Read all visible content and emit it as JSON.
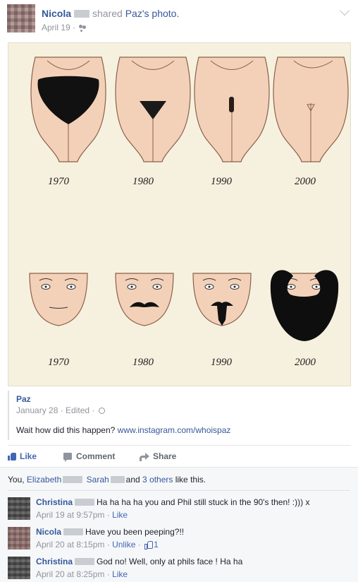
{
  "post": {
    "author": "Nicola",
    "action_text": "shared",
    "shared_owner": "Paz",
    "shared_suffix": "'s photo.",
    "date": "April 19",
    "separator": " · "
  },
  "photo": {
    "years_top": [
      "1970",
      "1980",
      "1990",
      "2000"
    ],
    "years_bottom": [
      "1970",
      "1980",
      "1990",
      "2000"
    ]
  },
  "shared": {
    "author": "Paz",
    "date": "January 28",
    "edited": "Edited",
    "caption_prefix": "Wait how did this happen? ",
    "caption_link": "www.instagram.com/whoispaz"
  },
  "actions": {
    "like": "Like",
    "comment": "Comment",
    "share": "Share"
  },
  "likes": {
    "you": "You, ",
    "name1": "Elizabeth",
    "name2": "Sarah",
    "and": "and ",
    "others": "3 others",
    "suffix": " like this."
  },
  "comments": [
    {
      "name": "Christina",
      "text": "Ha ha ha ha you and Phil still stuck in the 90's then! :))) x",
      "time": "April 19 at 9:57pm",
      "action": "Like"
    },
    {
      "name": "Nicola",
      "text": "Have you been peeping?!!",
      "time": "April 20 at 8:15pm",
      "action": "Unlike",
      "like_count": "1"
    },
    {
      "name": "Christina",
      "text": "God no! Well, only at phils face ! Ha ha",
      "time": "April 20 at 8:25pm",
      "action": "Like"
    }
  ]
}
